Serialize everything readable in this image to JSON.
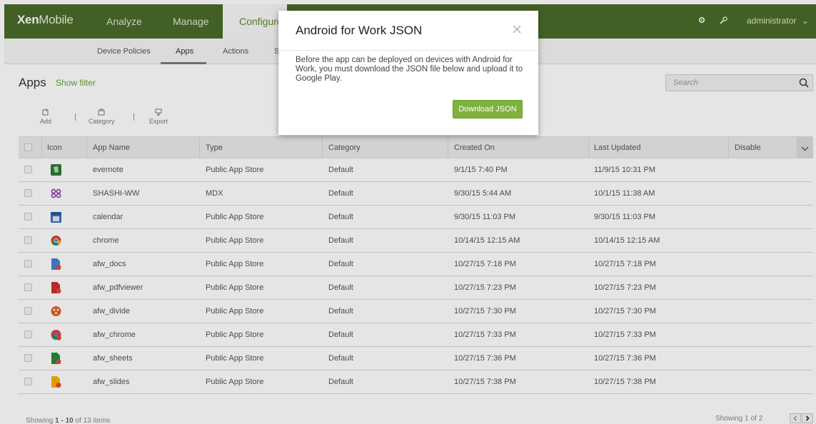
{
  "app": {
    "logo_bold": "Xen",
    "logo_light": "Mobile"
  },
  "topnav": {
    "items": [
      {
        "label": "Analyze"
      },
      {
        "label": "Manage"
      },
      {
        "label": "Configure"
      }
    ],
    "active": "Configure",
    "user": "administrator",
    "icons": [
      "gear-icon",
      "wrench-icon",
      "chevron-down-icon"
    ]
  },
  "subnav": {
    "items": [
      {
        "label": "Device Policies"
      },
      {
        "label": "Apps"
      },
      {
        "label": "Actions"
      },
      {
        "label": "S"
      }
    ],
    "active": "Apps"
  },
  "page": {
    "title": "Apps",
    "show_filter": "Show filter",
    "search_placeholder": "Search"
  },
  "toolbar": {
    "add": "Add",
    "category": "Category",
    "export": "Export"
  },
  "table": {
    "columns": [
      "Icon",
      "App Name",
      "Type",
      "Category",
      "Created On",
      "Last Updated",
      "Disable"
    ],
    "rows": [
      {
        "icon": "evernote-icon",
        "name": "evernote",
        "type": "Public App Store",
        "category": "Default",
        "created": "9/1/15 7:40 PM",
        "updated": "11/9/15 10:31 PM"
      },
      {
        "icon": "mdx-icon",
        "name": "SHASHI-WW",
        "type": "MDX",
        "category": "Default",
        "created": "9/30/15 5:44 AM",
        "updated": "10/1/15 11:38 AM"
      },
      {
        "icon": "calendar-icon",
        "name": "calendar",
        "type": "Public App Store",
        "category": "Default",
        "created": "9/30/15 11:03 PM",
        "updated": "9/30/15 11:03 PM"
      },
      {
        "icon": "chrome-icon",
        "name": "chrome",
        "type": "Public App Store",
        "category": "Default",
        "created": "10/14/15 12:15 AM",
        "updated": "10/14/15 12:15 AM"
      },
      {
        "icon": "docs-icon",
        "name": "afw_docs",
        "type": "Public App Store",
        "category": "Default",
        "created": "10/27/15 7:18 PM",
        "updated": "10/27/15 7:18 PM"
      },
      {
        "icon": "pdfviewer-icon",
        "name": "afw_pdfviewer",
        "type": "Public App Store",
        "category": "Default",
        "created": "10/27/15 7:23 PM",
        "updated": "10/27/15 7:23 PM"
      },
      {
        "icon": "divide-icon",
        "name": "afw_divide",
        "type": "Public App Store",
        "category": "Default",
        "created": "10/27/15 7:30 PM",
        "updated": "10/27/15 7:30 PM"
      },
      {
        "icon": "chrome-work-icon",
        "name": "afw_chrome",
        "type": "Public App Store",
        "category": "Default",
        "created": "10/27/15 7:33 PM",
        "updated": "10/27/15 7:33 PM"
      },
      {
        "icon": "sheets-icon",
        "name": "afw_sheets",
        "type": "Public App Store",
        "category": "Default",
        "created": "10/27/15 7:36 PM",
        "updated": "10/27/15 7:36 PM"
      },
      {
        "icon": "slides-icon",
        "name": "afw_slides",
        "type": "Public App Store",
        "category": "Default",
        "created": "10/27/15 7:38 PM",
        "updated": "10/27/15 7:38 PM"
      }
    ]
  },
  "footer": {
    "showing_prefix": "Showing ",
    "showing_range": "1 - 10",
    "showing_suffix": " of 13 items",
    "page_info": "Showing 1 of 2"
  },
  "modal": {
    "title": "Android for Work JSON",
    "body": "Before the app can be deployed on devices with Android for Work, you must download the JSON file below and upload it to Google Play.",
    "button": "Download JSON"
  },
  "colors": {
    "topnav_bg": "#4a6b2a",
    "accent_green": "#7fb23f",
    "link_green": "#6fa13a"
  }
}
